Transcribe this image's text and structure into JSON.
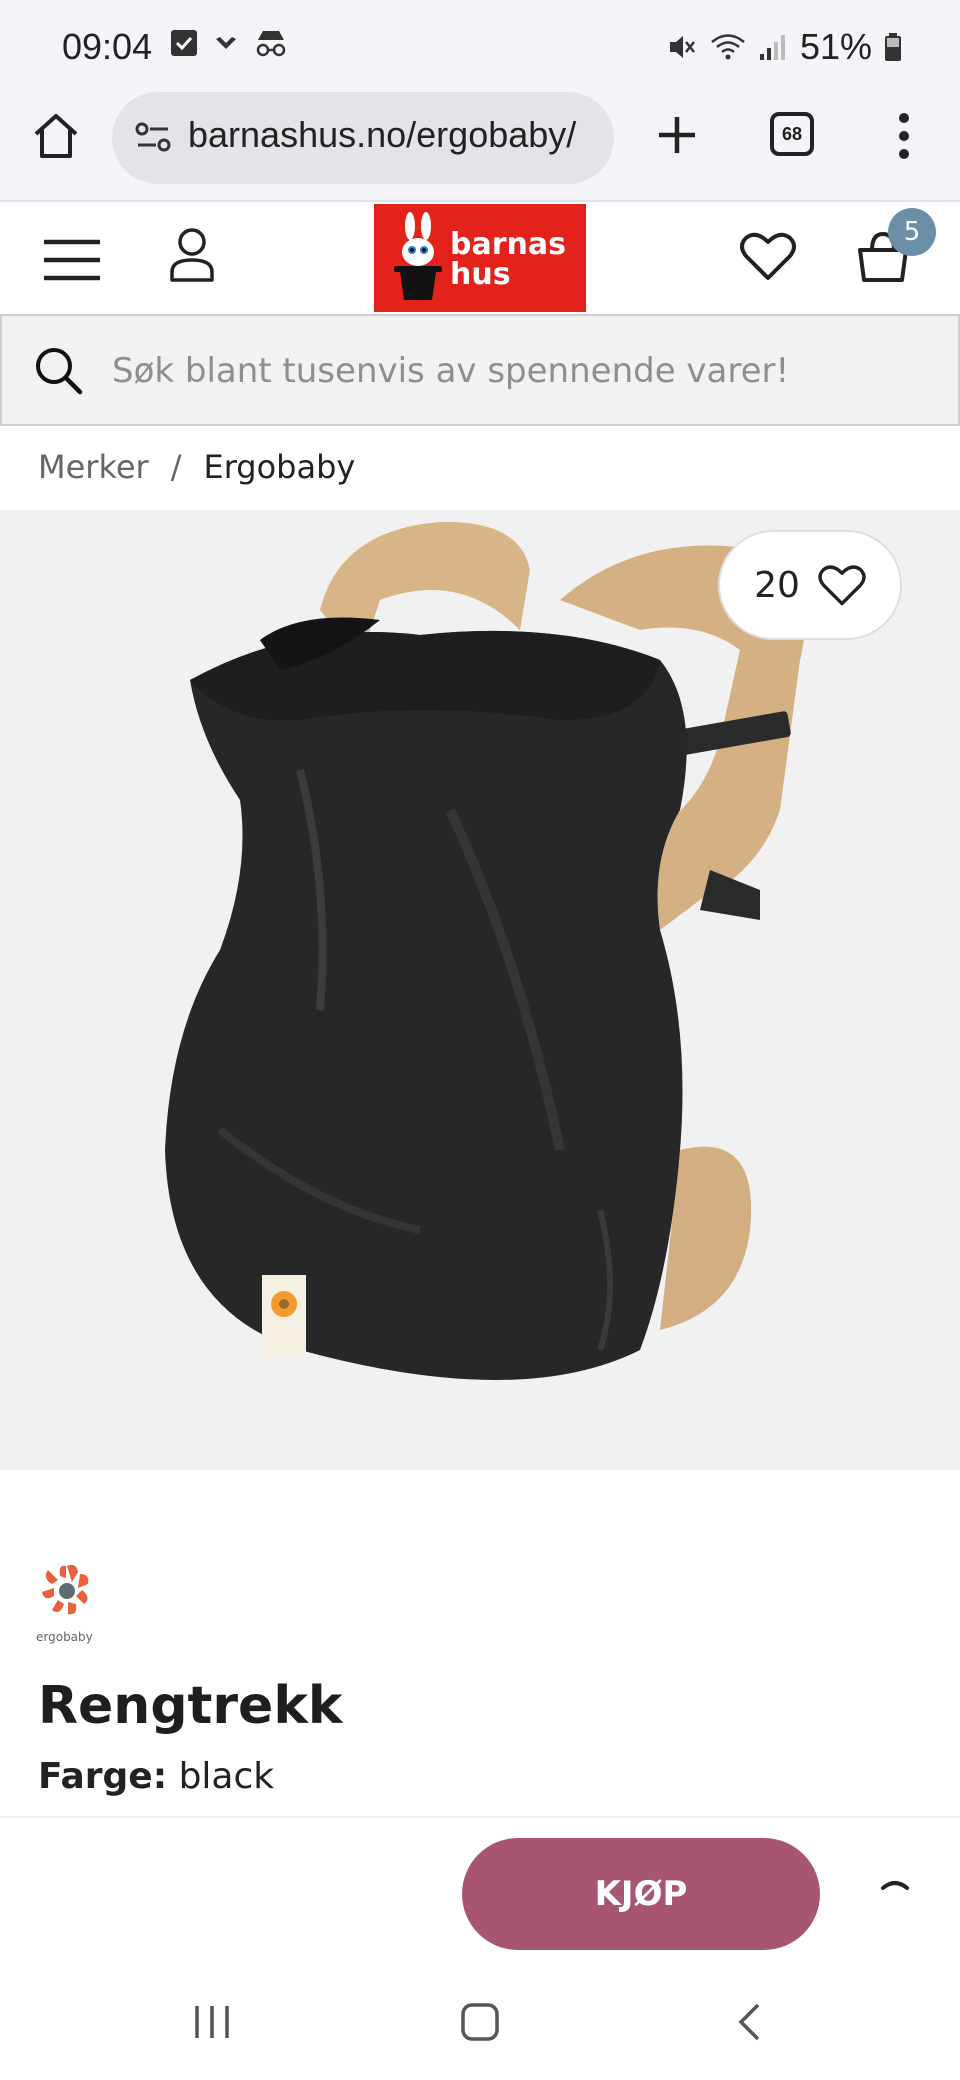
{
  "status_bar": {
    "time": "09:04",
    "battery": "51%",
    "icons": [
      "checkbox-icon",
      "chevron-down-icon",
      "incognito-icon",
      "mute-icon",
      "wifi-icon",
      "signal-icon",
      "battery-icon"
    ]
  },
  "browser": {
    "url": "barnashus.no/ergobaby/",
    "tab_count": "68"
  },
  "header": {
    "logo_line1": "barnas",
    "logo_line2": "hus",
    "cart_count": "5"
  },
  "search": {
    "placeholder": "Søk blant tusenvis av spennende varer!"
  },
  "breadcrumb": {
    "items": [
      "Merker",
      "Ergobaby"
    ],
    "separator": "/"
  },
  "product": {
    "favorites_count": "20",
    "brand_logo_text": "ergobaby",
    "title": "Rengtrekk",
    "color_label": "Farge:",
    "color_value": "black",
    "buy_label": "KJØP"
  },
  "colors": {
    "brand_red": "#e3221b",
    "buy_button": "#a8566f",
    "cart_badge": "#6b8fa6"
  }
}
